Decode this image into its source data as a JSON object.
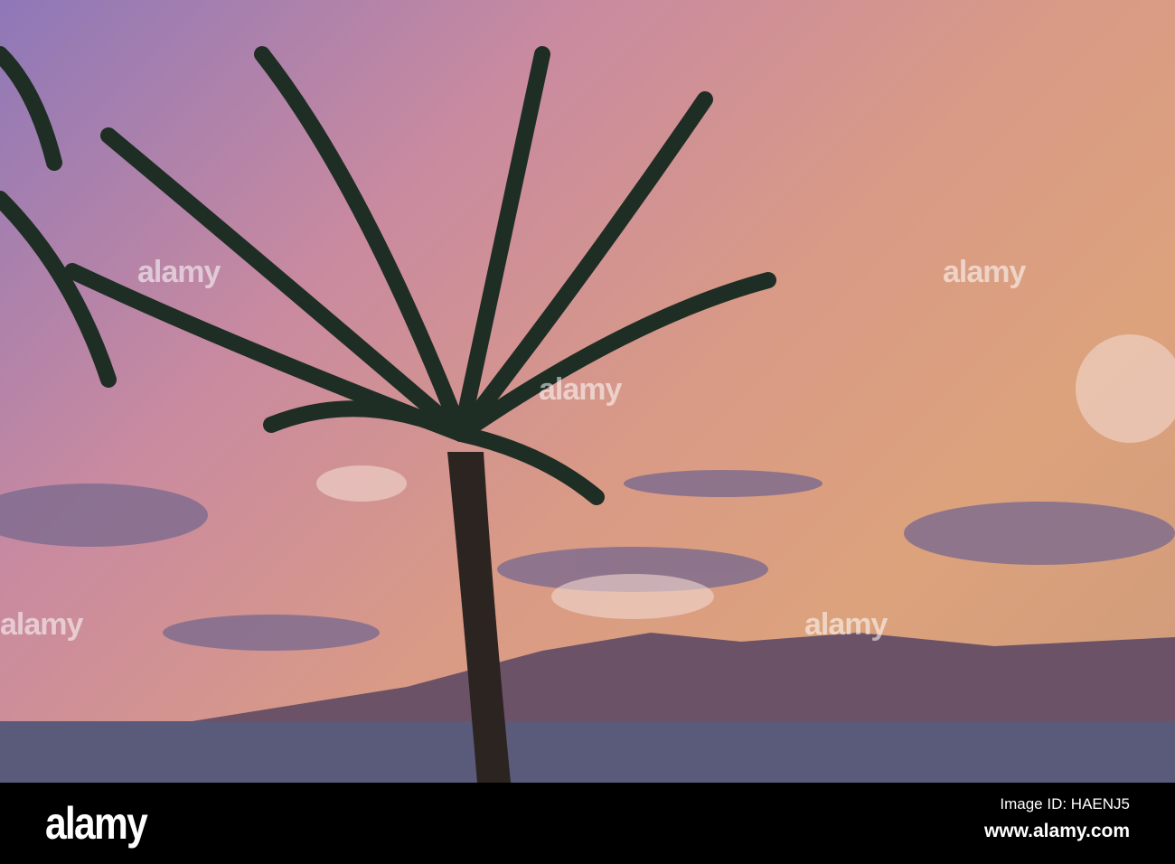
{
  "watermark": "alamy",
  "footer": {
    "logo": "alamy",
    "image_id": "Image ID: HAENJ5",
    "url": "www.alamy.com"
  }
}
